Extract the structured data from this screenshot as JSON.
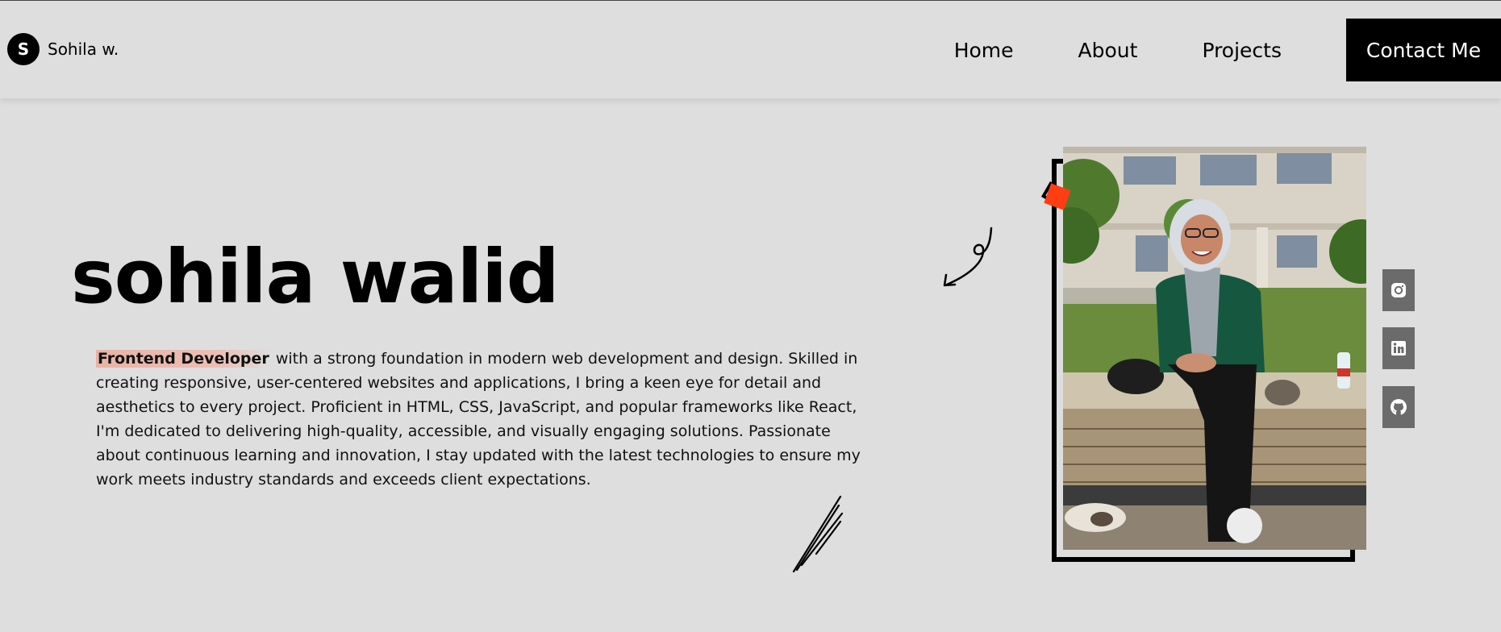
{
  "header": {
    "brand_initial": "S",
    "brand_name": "Sohila w.",
    "nav": [
      "Home",
      "About",
      "Projects"
    ],
    "contact_label": "Contact Me"
  },
  "hero": {
    "title": "sohila walid",
    "highlight": "Frontend Developer",
    "description": " with a strong foundation in modern web development and design. Skilled in creating responsive, user-centered websites and applications, I bring a keen eye for detail and aesthetics to every project. Proficient in HTML, CSS, JavaScript, and popular frameworks like React, I'm dedicated to delivering high-quality, accessible, and visually engaging solutions. Passionate about continuous learning and innovation, I stay updated with the latest technologies to ensure my work meets industry standards and exceeds client expectations."
  },
  "social": [
    "instagram-icon",
    "linkedin-icon",
    "github-icon"
  ],
  "colors": {
    "background": "#dedede",
    "accent": "#ff3d12",
    "highlight": "#e8b3a6",
    "social_bg": "#6b6b6b"
  }
}
